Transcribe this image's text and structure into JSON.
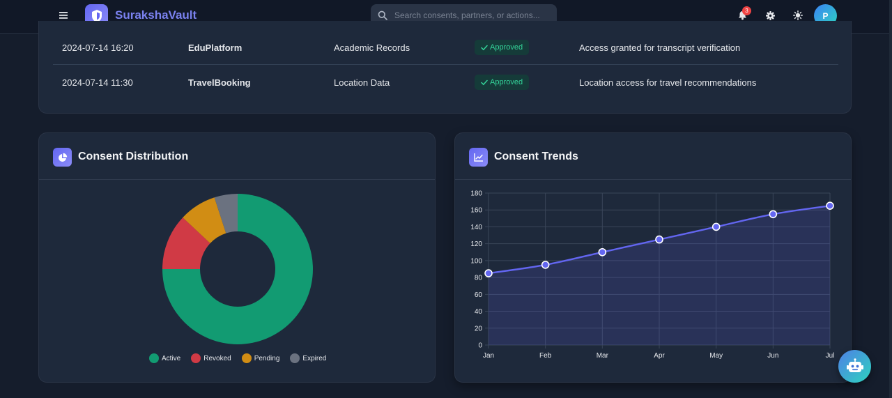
{
  "header": {
    "brand": "SurakshaVault",
    "search_placeholder": "Search consents, partners, or actions...",
    "notification_count": "3",
    "avatar_initial": "P"
  },
  "recent_activity": {
    "rows": [
      {
        "time": "2024-07-14 16:20",
        "partner": "EduPlatform",
        "data_type": "Academic Records",
        "status": "Approved",
        "description": "Access granted for transcript verification"
      },
      {
        "time": "2024-07-14 11:30",
        "partner": "TravelBooking",
        "data_type": "Location Data",
        "status": "Approved",
        "description": "Location access for travel recommendations"
      }
    ]
  },
  "distribution_card": {
    "title": "Consent Distribution"
  },
  "trends_card": {
    "title": "Consent Trends"
  },
  "colors": {
    "accent": "#6366f1",
    "active": "#129b72",
    "revoked": "#d03a45",
    "pending": "#d18d14",
    "expired": "#6b7280",
    "approved_text": "#34d399"
  },
  "icons": {
    "menu": "menu-icon",
    "logo": "shield-icon",
    "search": "search-icon",
    "bell": "bell-icon",
    "settings": "gear-icon",
    "theme": "sun-icon",
    "distribution": "pie-chart-icon",
    "trends": "line-chart-icon",
    "assistant": "robot-icon"
  },
  "chart_data": [
    {
      "type": "pie",
      "title": "Consent Distribution",
      "donut": true,
      "categories": [
        "Active",
        "Revoked",
        "Pending",
        "Expired"
      ],
      "values": [
        75,
        12,
        8,
        5
      ],
      "legend": "bottom"
    },
    {
      "type": "area",
      "title": "Consent Trends",
      "categories": [
        "Jan",
        "Feb",
        "Mar",
        "Apr",
        "May",
        "Jun",
        "Jul"
      ],
      "values": [
        85,
        95,
        110,
        125,
        140,
        155,
        165
      ],
      "ylim": [
        0,
        180
      ],
      "yticks": [
        0,
        20,
        40,
        60,
        80,
        100,
        120,
        140,
        160,
        180
      ],
      "grid": true
    }
  ]
}
